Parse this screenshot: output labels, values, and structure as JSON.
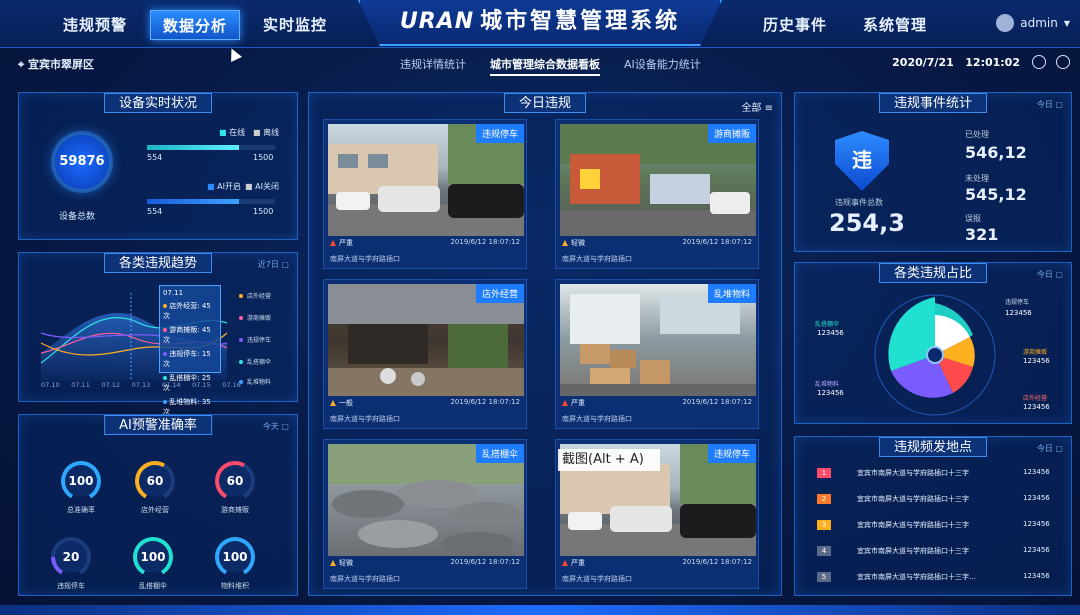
{
  "header": {
    "nav_left": [
      "违规预警",
      "数据分析",
      "实时监控"
    ],
    "nav_right": [
      "历史事件",
      "系统管理"
    ],
    "logo": "URAN",
    "title": "城市智慧管理系统",
    "user": "admin"
  },
  "subbar": {
    "location": "宜宾市翠屏区",
    "tabs": [
      "违规详情统计",
      "城市管理综合数据看板",
      "AI设备能力统计"
    ],
    "date": "2020/7/21",
    "time": "12:01:02"
  },
  "device": {
    "title": "设备实时状况",
    "total": "59876",
    "total_label": "设备总数",
    "legend1": [
      "在线",
      "离线"
    ],
    "legend2": [
      "AI开启",
      "AI关闭"
    ],
    "bar1": {
      "left": "554",
      "right": "1500"
    },
    "bar2": {
      "left": "554",
      "right": "1500"
    }
  },
  "trend": {
    "title": "各类违规趋势",
    "range": "近7日",
    "tooltip": {
      "date": "07.11",
      "rows": [
        "店外经营: 45次",
        "游商摊贩: 45次",
        "违规停车: 15次",
        "乱搭棚伞: 25次",
        "乱堆物料: 35次"
      ]
    },
    "x_labels": [
      "07.10",
      "07.11",
      "07.12",
      "07.13",
      "07.14",
      "07.15",
      "07.16"
    ],
    "legend": [
      "店外经营",
      "游商摊贩",
      "违规停车",
      "乱搭棚伞",
      "乱堆物料"
    ]
  },
  "accuracy": {
    "title": "AI预警准确率",
    "range": "今天",
    "gauges": [
      {
        "value": "100",
        "label": "总准确率",
        "fill": 1.0
      },
      {
        "value": "60",
        "label": "店外经营",
        "fill": 0.6
      },
      {
        "value": "60",
        "label": "游商摊贩",
        "fill": 0.6
      },
      {
        "value": "20",
        "label": "违规停车",
        "fill": 0.2
      },
      {
        "value": "100",
        "label": "乱搭棚伞",
        "fill": 1.0
      },
      {
        "value": "100",
        "label": "物料堆积",
        "fill": 1.0
      }
    ]
  },
  "today": {
    "title": "今日违规",
    "filter": "全部",
    "cards": [
      {
        "tag": "违规停车",
        "level": "严重",
        "time": "2019/6/12   18:07:12",
        "addr": "南屏大道与学府路插口"
      },
      {
        "tag": "游商摊贩",
        "level": "轻微",
        "time": "2019/6/12   18:07:12",
        "addr": "南屏大道与学府路插口"
      },
      {
        "tag": "店外经营",
        "level": "一般",
        "time": "2019/6/12   18:07:12",
        "addr": "南屏大道与学府路插口"
      },
      {
        "tag": "乱堆物料",
        "level": "严重",
        "time": "2019/6/12   18:07:12",
        "addr": "南屏大道与学府路插口"
      },
      {
        "tag": "乱搭棚伞",
        "level": "轻微",
        "time": "2019/6/12   18:07:12",
        "addr": "南屏大道与学府路插口"
      },
      {
        "tag": "违规停车",
        "level": "严重",
        "time": "2019/6/12   18:07:12",
        "addr": "南屏大道与学府路插口"
      }
    ]
  },
  "events": {
    "title": "违规事件统计",
    "range": "今日",
    "shield": "违",
    "total_label": "违规事件总数",
    "total": "254,3",
    "handled_label": "已处理",
    "handled": "546,12",
    "unhandled_label": "未处理",
    "unhandled": "545,12",
    "false_label": "误报",
    "false": "321"
  },
  "ratio": {
    "title": "各类违规占比",
    "range": "今日",
    "items": [
      {
        "label": "违规停车",
        "value": "123456",
        "color": "#ffffff"
      },
      {
        "label": "游商摊贩",
        "value": "123456",
        "color": "#ffb020"
      },
      {
        "label": "店外经营",
        "value": "123456",
        "color": "#ff4b4b"
      },
      {
        "label": "乱堆物料",
        "value": "123456",
        "color": "#7b5cff"
      },
      {
        "label": "乱搭棚伞",
        "value": "123456",
        "color": "#21e0d0"
      }
    ]
  },
  "hotspots": {
    "title": "违规频发地点",
    "range": "今日",
    "rows": [
      {
        "no": "1",
        "addr": "宜宾市南屏大道与学府路插口十三字",
        "val": "123456",
        "color": "#ff4b6b"
      },
      {
        "no": "2",
        "addr": "宜宾市南屏大道与学府路插口十三字",
        "val": "123456",
        "color": "#ff7a2b"
      },
      {
        "no": "3",
        "addr": "宜宾市南屏大道与学府路插口十三字",
        "val": "123456",
        "color": "#ffb020"
      },
      {
        "no": "4",
        "addr": "宜宾市南屏大道与学府路插口十三字",
        "val": "123456",
        "color": "#5a6a8a"
      },
      {
        "no": "5",
        "addr": "宜宾市南屏大道与学府路插口十三字...",
        "val": "123456",
        "color": "#5a6a8a"
      }
    ]
  },
  "overlay": "截图(Alt + A)"
}
